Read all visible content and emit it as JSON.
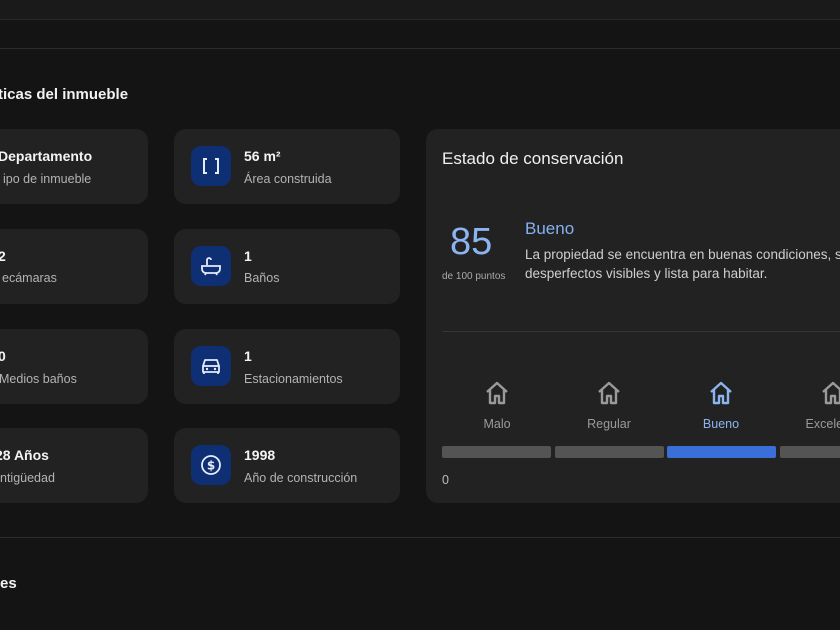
{
  "section": {
    "title": "ticas del inmueble",
    "next_title": "es"
  },
  "features": [
    {
      "value": "Departamento",
      "label": "ipo de inmueble",
      "icon": "building-icon"
    },
    {
      "value": "56 m²",
      "label": "Área construida",
      "icon": "area-brackets-icon"
    },
    {
      "value": "2",
      "label": "ecámaras",
      "icon": "bed-icon"
    },
    {
      "value": "1",
      "label": "Baños",
      "icon": "bathtub-icon"
    },
    {
      "value": "0",
      "label": "Medios baños",
      "icon": "half-bath-icon"
    },
    {
      "value": "1",
      "label": "Estacionamientos",
      "icon": "car-icon"
    },
    {
      "value": "28 Años",
      "label": "ntigüedad",
      "icon": "calendar-icon"
    },
    {
      "value": "1998",
      "label": "Año de construcción",
      "icon": "dollar-circle-icon"
    }
  ],
  "conservation": {
    "title": "Estado de conservación",
    "score": "85",
    "score_sub": "de 100 puntos",
    "status": "Bueno",
    "description": "La propiedad se encuentra en buenas condiciones, sin desperfectos visibles y lista para habitar.",
    "levels": [
      {
        "label": "Malo",
        "icon": "house-icon",
        "active": false
      },
      {
        "label": "Regular",
        "icon": "house-icon",
        "active": false
      },
      {
        "label": "Bueno",
        "icon": "house-icon",
        "active": true
      },
      {
        "label": "Excelente",
        "icon": "house-icon",
        "active": false
      }
    ],
    "scale_min": "0"
  },
  "colors": {
    "background": "#141414",
    "card": "#222222",
    "icon_bg": "#0e2f73",
    "accent": "#3a6fd8",
    "accent_text": "#8cb4f0"
  }
}
